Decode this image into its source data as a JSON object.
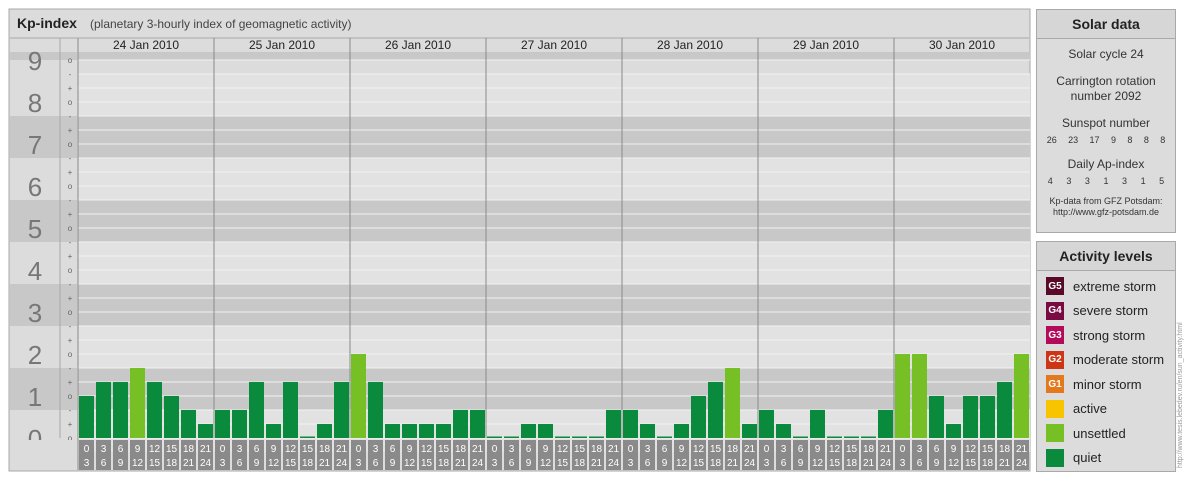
{
  "header": {
    "title": "Kp-index",
    "subtitle": "(planetary 3-hourly index of geomagnetic activity)"
  },
  "solar": {
    "title": "Solar data",
    "cycle": "Solar cycle 24",
    "carrington_line1": "Carrington rotation",
    "carrington_line2": "number 2092",
    "sunspot_label": "Sunspot number",
    "sunspot_values": [
      "26",
      "23",
      "17",
      "9",
      "8",
      "8",
      "8"
    ],
    "ap_label": "Daily Ap-index",
    "ap_values": [
      "4",
      "3",
      "3",
      "1",
      "3",
      "1",
      "5"
    ],
    "source_line1": "Kp-data from GFZ Potsdam:",
    "source_line2": "http://www.gfz-potsdam.de"
  },
  "activity": {
    "title": "Activity levels",
    "levels": [
      {
        "code": "G5",
        "label": "extreme storm",
        "color": "#5a0a28"
      },
      {
        "code": "G4",
        "label": "severe storm",
        "color": "#7a0a42"
      },
      {
        "code": "G3",
        "label": "strong storm",
        "color": "#b40a5a"
      },
      {
        "code": "G2",
        "label": "moderate storm",
        "color": "#cd3515"
      },
      {
        "code": "G1",
        "label": "minor storm",
        "color": "#e4781d"
      },
      {
        "code": "",
        "label": "active",
        "color": "#f8c400"
      },
      {
        "code": "",
        "label": "unsettled",
        "color": "#76c025"
      },
      {
        "code": "",
        "label": "quiet",
        "color": "#0a8a3c"
      }
    ]
  },
  "credit": "http://www.tesis.lebedev.ru/en/sun_activity.html",
  "chart_data": {
    "type": "bar",
    "title": "Kp-index",
    "subtitle": "(planetary 3-hourly index of geomagnetic activity)",
    "ylim": [
      0,
      9
    ],
    "y_ticks": [
      "0",
      "1",
      "2",
      "3",
      "4",
      "5",
      "6",
      "7",
      "8",
      "9"
    ],
    "minor_ticks": [
      "-",
      "o",
      "+"
    ],
    "interval_starts": [
      "0",
      "3",
      "6",
      "9",
      "12",
      "15",
      "18",
      "21"
    ],
    "interval_ends": [
      "3",
      "6",
      "9",
      "12",
      "15",
      "18",
      "21",
      "24"
    ],
    "days": [
      {
        "date": "24 Jan 2010",
        "values": [
          1.0,
          1.333,
          1.333,
          1.667,
          1.333,
          1.0,
          0.667,
          0.333
        ]
      },
      {
        "date": "25 Jan 2010",
        "values": [
          0.667,
          0.667,
          1.333,
          0.333,
          1.333,
          0,
          0.333,
          1.333
        ]
      },
      {
        "date": "26 Jan 2010",
        "values": [
          2.0,
          1.333,
          0.333,
          0.333,
          0.333,
          0.333,
          0.667,
          0.667
        ]
      },
      {
        "date": "27 Jan 2010",
        "values": [
          0,
          0,
          0.333,
          0.333,
          0,
          0,
          0,
          0.667
        ]
      },
      {
        "date": "28 Jan 2010",
        "values": [
          0.667,
          0.333,
          0,
          0.333,
          1.0,
          1.333,
          1.667,
          0.333
        ]
      },
      {
        "date": "29 Jan 2010",
        "values": [
          0.667,
          0.333,
          0,
          0.667,
          0,
          0,
          0,
          0.667
        ]
      },
      {
        "date": "30 Jan 2010",
        "values": [
          2.0,
          2.0,
          1.0,
          0.333,
          1.0,
          1.0,
          1.333,
          2.0
        ]
      }
    ],
    "color_thresholds": {
      "quiet": "#0a8a3c",
      "unsettled": "#76c025",
      "active": "#f8c400"
    },
    "grid": true
  }
}
